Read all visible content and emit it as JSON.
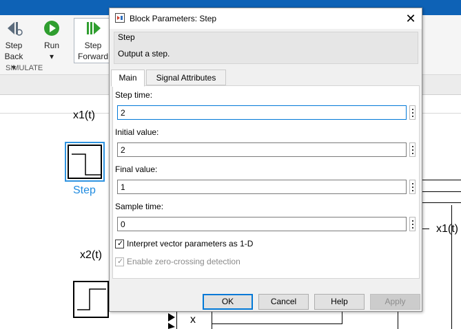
{
  "toolstrip": {
    "step_back_label_1": "Step",
    "step_back_label_2": "Back ▾",
    "run_label": "Run",
    "run_label_2": "▾",
    "step_forward_label_1": "Step",
    "step_forward_label_2": "Forward",
    "section_label": "SIMULATE"
  },
  "canvas": {
    "signal_x1_top": "x1(t)",
    "step_block_caption": "Step",
    "signal_x2": "x2(t)",
    "signal_x1_right": "x1(t)",
    "port_label_x": "x"
  },
  "dialog": {
    "title": "Block Parameters: Step",
    "close_glyph": "✕",
    "group_title": "Step",
    "group_description": "Output a step.",
    "tabs": [
      {
        "label": "Main",
        "active": true
      },
      {
        "label": "Signal Attributes",
        "active": false
      }
    ],
    "fields": [
      {
        "label": "Step time:",
        "value": "2"
      },
      {
        "label": "Initial value:",
        "value": "2"
      },
      {
        "label": "Final value:",
        "value": "1"
      },
      {
        "label": "Sample time:",
        "value": "0"
      }
    ],
    "checkboxes": [
      {
        "label": "Interpret vector parameters as 1-D",
        "checked": true,
        "enabled": true
      },
      {
        "label": "Enable zero-crossing detection",
        "checked": true,
        "enabled": false
      }
    ],
    "buttons": {
      "ok": "OK",
      "cancel": "Cancel",
      "help": "Help",
      "apply": "Apply"
    }
  },
  "colors": {
    "accent_blue": "#0078d7",
    "selection_blue": "#2f93e0",
    "title_strip": "#0e62b6"
  }
}
